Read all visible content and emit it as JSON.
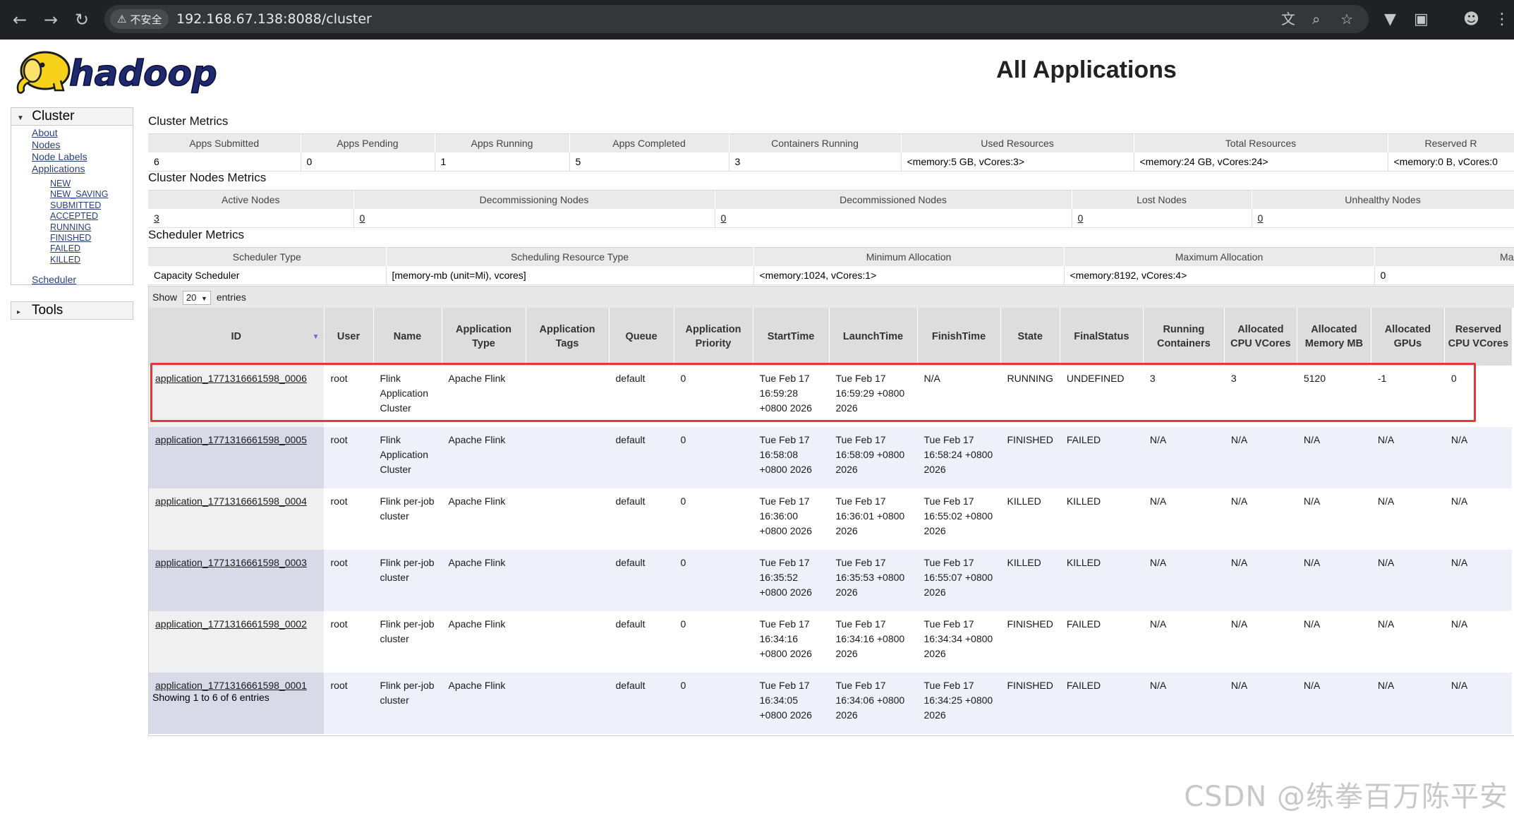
{
  "browser": {
    "security_label": "不安全",
    "url": "192.168.67.138:8088/cluster"
  },
  "header": {
    "logo_text": "hadoop",
    "title": "All Applications"
  },
  "nav": {
    "cluster_label": "Cluster",
    "links": [
      "About",
      "Nodes",
      "Node Labels",
      "Applications"
    ],
    "app_states": [
      "NEW",
      "NEW_SAVING",
      "SUBMITTED",
      "ACCEPTED",
      "RUNNING",
      "FINISHED",
      "FAILED",
      "KILLED"
    ],
    "scheduler_link": "Scheduler",
    "tools_label": "Tools"
  },
  "cluster_metrics": {
    "title": "Cluster Metrics",
    "headers": [
      "Apps Submitted",
      "Apps Pending",
      "Apps Running",
      "Apps Completed",
      "Containers Running",
      "Used Resources",
      "Total Resources",
      "Reserved R"
    ],
    "values": [
      "6",
      "0",
      "1",
      "5",
      "3",
      "<memory:5 GB, vCores:3>",
      "<memory:24 GB, vCores:24>",
      "<memory:0 B, vCores:0"
    ]
  },
  "node_metrics": {
    "title": "Cluster Nodes Metrics",
    "headers": [
      "Active Nodes",
      "Decommissioning Nodes",
      "Decommissioned Nodes",
      "Lost Nodes",
      "Unhealthy Nodes"
    ],
    "values": [
      "3",
      "0",
      "0",
      "0",
      "0"
    ]
  },
  "scheduler_metrics": {
    "title": "Scheduler Metrics",
    "headers": [
      "Scheduler Type",
      "Scheduling Resource Type",
      "Minimum Allocation",
      "Maximum Allocation",
      "Ma"
    ],
    "values": [
      "Capacity Scheduler",
      "[memory-mb (unit=Mi), vcores]",
      "<memory:1024, vCores:1>",
      "<memory:8192, vCores:4>",
      "0"
    ]
  },
  "apps": {
    "show_label": "Show",
    "page_size": "20",
    "entries_label": "entries",
    "columns": [
      "ID",
      "User",
      "Name",
      "Application Type",
      "Application Tags",
      "Queue",
      "Application Priority",
      "StartTime",
      "LaunchTime",
      "FinishTime",
      "State",
      "FinalStatus",
      "Running Containers",
      "Allocated CPU VCores",
      "Allocated Memory MB",
      "Allocated GPUs",
      "Reserved CPU VCores"
    ],
    "rows": [
      [
        "application_1771316661598_0006",
        "root",
        "Flink Application Cluster",
        "Apache Flink",
        "",
        "default",
        "0",
        "Tue Feb 17 16:59:28 +0800 2026",
        "Tue Feb 17 16:59:29 +0800 2026",
        "N/A",
        "RUNNING",
        "UNDEFINED",
        "3",
        "3",
        "5120",
        "-1",
        "0"
      ],
      [
        "application_1771316661598_0005",
        "root",
        "Flink Application Cluster",
        "Apache Flink",
        "",
        "default",
        "0",
        "Tue Feb 17 16:58:08 +0800 2026",
        "Tue Feb 17 16:58:09 +0800 2026",
        "Tue Feb 17 16:58:24 +0800 2026",
        "FINISHED",
        "FAILED",
        "N/A",
        "N/A",
        "N/A",
        "N/A",
        "N/A"
      ],
      [
        "application_1771316661598_0004",
        "root",
        "Flink per-job cluster",
        "Apache Flink",
        "",
        "default",
        "0",
        "Tue Feb 17 16:36:00 +0800 2026",
        "Tue Feb 17 16:36:01 +0800 2026",
        "Tue Feb 17 16:55:02 +0800 2026",
        "KILLED",
        "KILLED",
        "N/A",
        "N/A",
        "N/A",
        "N/A",
        "N/A"
      ],
      [
        "application_1771316661598_0003",
        "root",
        "Flink per-job cluster",
        "Apache Flink",
        "",
        "default",
        "0",
        "Tue Feb 17 16:35:52 +0800 2026",
        "Tue Feb 17 16:35:53 +0800 2026",
        "Tue Feb 17 16:55:07 +0800 2026",
        "KILLED",
        "KILLED",
        "N/A",
        "N/A",
        "N/A",
        "N/A",
        "N/A"
      ],
      [
        "application_1771316661598_0002",
        "root",
        "Flink per-job cluster",
        "Apache Flink",
        "",
        "default",
        "0",
        "Tue Feb 17 16:34:16 +0800 2026",
        "Tue Feb 17 16:34:16 +0800 2026",
        "Tue Feb 17 16:34:34 +0800 2026",
        "FINISHED",
        "FAILED",
        "N/A",
        "N/A",
        "N/A",
        "N/A",
        "N/A"
      ],
      [
        "application_1771316661598_0001",
        "root",
        "Flink per-job cluster",
        "Apache Flink",
        "",
        "default",
        "0",
        "Tue Feb 17 16:34:05 +0800 2026",
        "Tue Feb 17 16:34:06 +0800 2026",
        "Tue Feb 17 16:34:25 +0800 2026",
        "FINISHED",
        "FAILED",
        "N/A",
        "N/A",
        "N/A",
        "N/A",
        "N/A"
      ]
    ],
    "info": "Showing 1 to 6 of 6 entries"
  },
  "watermark": "CSDN @练拳百万陈平安",
  "colors": {
    "highlight": "#e0383e",
    "link": "#2a3f7f",
    "chrome_bg": "#202124"
  }
}
